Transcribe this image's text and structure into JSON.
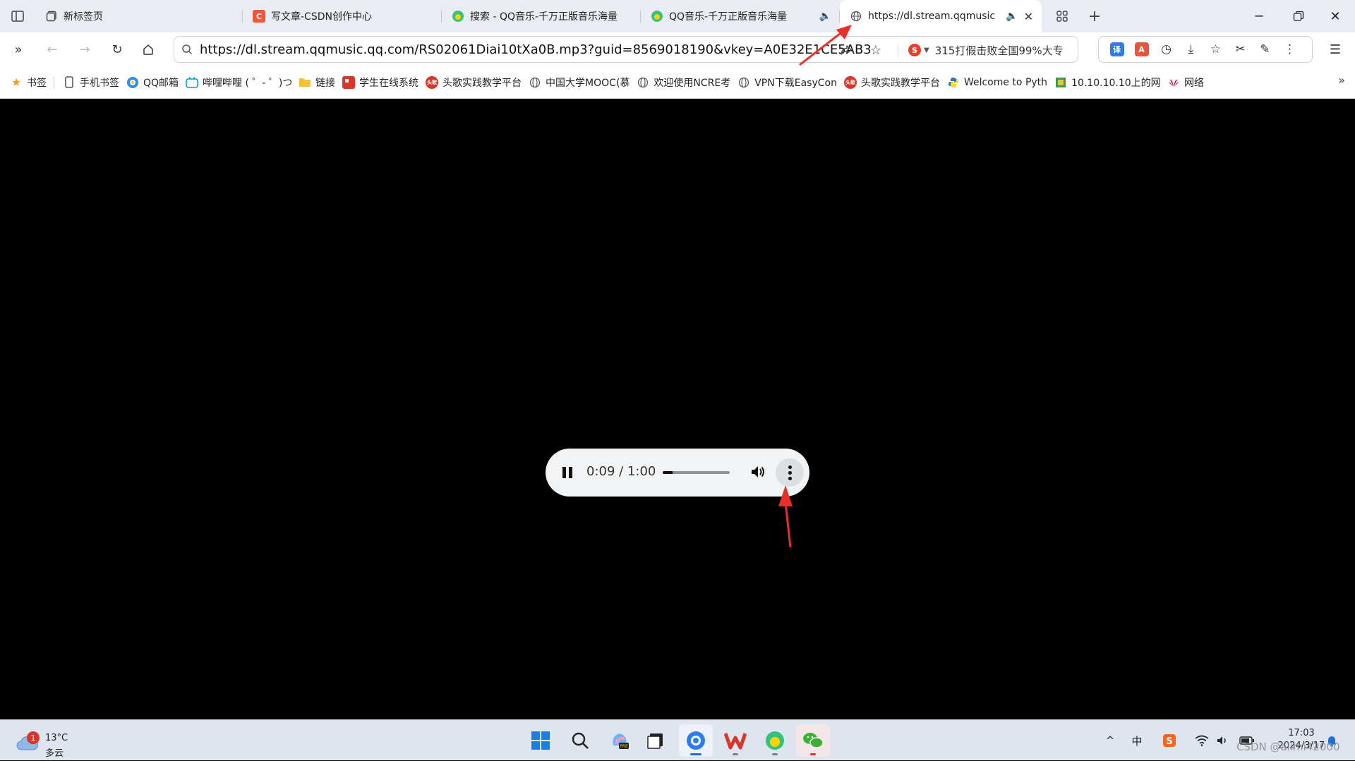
{
  "tabs": [
    {
      "title": "新标签页",
      "favicon": "new-tab-icon"
    },
    {
      "title": "写文章-CSDN创作中心",
      "favicon": "csdn-icon",
      "favicon_text": "C"
    },
    {
      "title": "搜索 - QQ音乐-千万正版音乐海量",
      "favicon": "qqmusic-icon"
    },
    {
      "title": "QQ音乐-千万正版音乐海量",
      "favicon": "qqmusic-icon",
      "audio": true
    },
    {
      "title": "https://dl.stream.qqmusic",
      "favicon": "globe-icon",
      "audio": true,
      "active": true
    }
  ],
  "address": {
    "url": "https://dl.stream.qqmusic.qq.com/RS02061Diai10tXa0B.mp3?guid=8569018190&vkey=A0E32E1CE5AB3",
    "hot_search": "315打假击败全国99%大专",
    "hot_search_badge": "S"
  },
  "bookmarks": [
    {
      "label": "书签",
      "icon": "star-icon",
      "color": "#f0a020"
    },
    {
      "label": "手机书签",
      "icon": "phone-icon"
    },
    {
      "label": "QQ邮箱",
      "icon": "qqmail-icon",
      "color": "#2d8cf0"
    },
    {
      "label": "哔哩哔哩 ( ゜- ゜)つ",
      "icon": "bilibili-icon",
      "color": "#00a1d6"
    },
    {
      "label": "链接",
      "icon": "folder-icon",
      "color": "#f4c430"
    },
    {
      "label": "学生在线系统",
      "icon": "school-icon",
      "color": "#d9352a"
    },
    {
      "label": "头歌实践教学平台",
      "icon": "educoder-icon",
      "color": "#d9352a",
      "icon_text": "头歌"
    },
    {
      "label": "中国大学MOOC(慕",
      "icon": "globe-icon"
    },
    {
      "label": "欢迎使用NCRE考",
      "icon": "globe-icon"
    },
    {
      "label": "VPN下载EasyCon",
      "icon": "globe-icon"
    },
    {
      "label": "头歌实践教学平台",
      "icon": "educoder-icon",
      "color": "#d9352a",
      "icon_text": "头歌"
    },
    {
      "label": "Welcome to Pyth",
      "icon": "python-icon"
    },
    {
      "label": "10.10.10.10上的网",
      "icon": "network-icon"
    },
    {
      "label": "网络",
      "icon": "huawei-icon",
      "color": "#cf0a2c"
    }
  ],
  "player": {
    "time": "0:09 / 1:00",
    "progress": 0.15
  },
  "taskbar": {
    "weather_badge": "1",
    "temperature": "13°C",
    "condition": "多云",
    "ime": "中",
    "time": "17:03",
    "date": "2024/3/17"
  },
  "watermark": "CSDN @alimi42000"
}
